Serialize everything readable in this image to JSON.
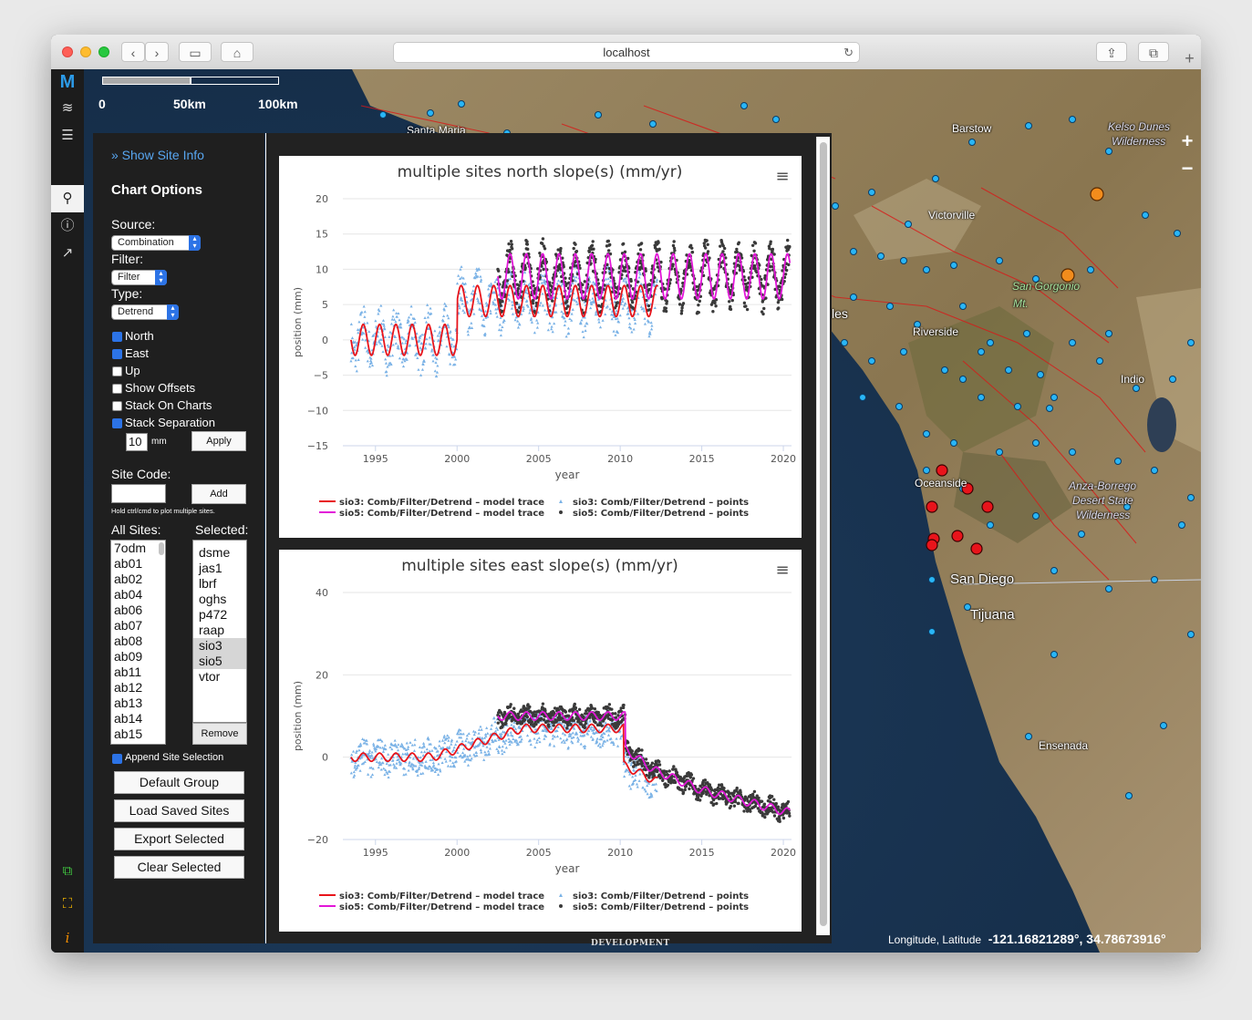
{
  "browser": {
    "url": "localhost"
  },
  "map": {
    "scale": [
      "0",
      "50km",
      "100km"
    ],
    "coords_label": "Longitude, Latitude",
    "coords_value": "-121.16821289°, 34.78673916°",
    "dev_label": "DEVELOPMENT",
    "places": [
      "Santa Maria",
      "Barstow",
      "Kelso Dunes",
      "Wilderness",
      "Victorville",
      "San Gorgonio",
      "Mt.",
      "Riverside",
      "Indio",
      "Oceanside",
      "Anza-Borrego",
      "Desert State",
      "Wilderness",
      "San Diego",
      "Tijuana",
      "Ensenada",
      "les"
    ],
    "zoom_in": "+",
    "zoom_out": "−"
  },
  "toolbar": {
    "logo": "M"
  },
  "panel": {
    "show_site_info": "» Show Site Info",
    "chart_options": "Chart Options",
    "source_label": "Source:",
    "source_value": "Combination",
    "filter_label": "Filter:",
    "filter_value": "Filter",
    "type_label": "Type:",
    "type_value": "Detrend",
    "checks": [
      {
        "label": "North",
        "checked": true
      },
      {
        "label": "East",
        "checked": true
      },
      {
        "label": "Up",
        "checked": false
      },
      {
        "label": "Show Offsets",
        "checked": false
      },
      {
        "label": "Stack On Charts",
        "checked": false
      },
      {
        "label": "Stack Separation",
        "checked": true
      }
    ],
    "separation_value": "10",
    "separation_unit": "mm",
    "apply_label": "Apply",
    "site_code_label": "Site Code:",
    "site_code_value": "",
    "add_label": "Add",
    "hint": "Hold ctrl/cmd to plot multiple sites.",
    "all_sites_label": "All Sites:",
    "selected_label": "Selected:",
    "all_sites": [
      "7odm",
      "ab01",
      "ab02",
      "ab04",
      "ab06",
      "ab07",
      "ab08",
      "ab09",
      "ab11",
      "ab12",
      "ab13",
      "ab14",
      "ab15"
    ],
    "selected_sites": [
      "dsme",
      "jas1",
      "lbrf",
      "oghs",
      "p472",
      "raap",
      "sio3",
      "sio5",
      "vtor"
    ],
    "highlighted_sites": [
      "sio3",
      "sio5"
    ],
    "remove_label": "Remove",
    "append_label": "Append Site Selection",
    "append_checked": true,
    "buttons": [
      "Default Group",
      "Load Saved Sites",
      "Export Selected",
      "Clear Selected"
    ]
  },
  "chart_data": [
    {
      "type": "line",
      "title": "multiple sites north slope(s) (mm/yr)",
      "xlabel": "year",
      "ylabel": "position (mm)",
      "xlim": [
        1993,
        2020.5
      ],
      "ylim": [
        -15,
        20
      ],
      "xticks": [
        1995,
        2000,
        2005,
        2010,
        2015,
        2020
      ],
      "yticks": [
        20,
        15,
        10,
        5,
        0,
        -5,
        -10,
        -15
      ],
      "series": [
        {
          "name": "sio3: Comb/Filter/Detrend – model trace",
          "color": "#e8141b",
          "style": "line",
          "offset": [
            [
              1993.5,
              0
            ],
            [
              2000.0,
              0
            ],
            [
              2000.01,
              5.5
            ],
            [
              2012.3,
              5.5
            ]
          ],
          "amplitude": 2.2
        },
        {
          "name": "sio5: Comb/Filter/Detrend – model trace",
          "color": "#e216d8",
          "style": "line",
          "offset": [
            [
              2002.5,
              9
            ],
            [
              2020.4,
              9
            ]
          ],
          "amplitude": 3.2
        },
        {
          "name": "sio3: Comb/Filter/Detrend – points",
          "color": "#7ab2e6",
          "style": "points",
          "range": [
            1993.5,
            2012.3
          ],
          "ref": "sio3-model",
          "spread": 3.0
        },
        {
          "name": "sio5: Comb/Filter/Detrend – points",
          "color": "#3a3a3a",
          "style": "points",
          "range": [
            2002.5,
            2020.4
          ],
          "ref": "sio5-model",
          "spread": 2.2
        }
      ]
    },
    {
      "type": "line",
      "title": "multiple sites east slope(s) (mm/yr)",
      "xlabel": "year",
      "ylabel": "position (mm)",
      "xlim": [
        1993,
        2020.5
      ],
      "ylim": [
        -20,
        40
      ],
      "xticks": [
        1995,
        2000,
        2005,
        2010,
        2015,
        2020
      ],
      "yticks": [
        40,
        20,
        0,
        -20
      ],
      "series": [
        {
          "name": "sio3: Comb/Filter/Detrend – model trace",
          "color": "#e8141b",
          "style": "line",
          "offset": [
            [
              1993.5,
              0
            ],
            [
              1998.5,
              0
            ],
            [
              2004,
              7
            ],
            [
              2010.2,
              7
            ],
            [
              2010.21,
              -2
            ],
            [
              2012.3,
              -6
            ]
          ],
          "amplitude": 1.0
        },
        {
          "name": "sio5: Comb/Filter/Detrend – model trace",
          "color": "#e216d8",
          "style": "line",
          "offset": [
            [
              2002.5,
              10
            ],
            [
              2010.3,
              10
            ],
            [
              2010.31,
              2
            ],
            [
              2012.0,
              -3
            ],
            [
              2015,
              -8
            ],
            [
              2020.4,
              -13.5
            ]
          ],
          "amplitude": 1.0
        },
        {
          "name": "sio3: Comb/Filter/Detrend – points",
          "color": "#7ab2e6",
          "style": "points",
          "range": [
            1993.5,
            2012.3
          ],
          "ref": "sio3-model",
          "spread": 4.0
        },
        {
          "name": "sio5: Comb/Filter/Detrend – points",
          "color": "#3a3a3a",
          "style": "points",
          "range": [
            2002.5,
            2020.4
          ],
          "ref": "sio5-model",
          "spread": 2.0
        }
      ]
    }
  ]
}
